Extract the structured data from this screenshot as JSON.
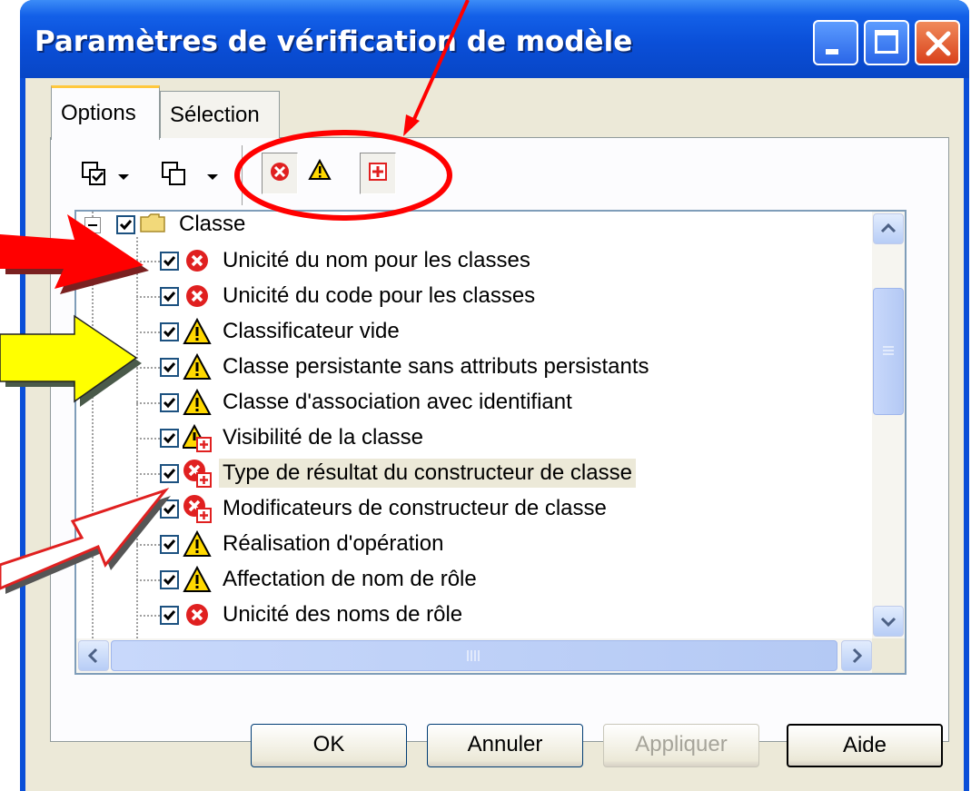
{
  "window": {
    "title": "Paramètres de vérification de modèle",
    "accent": "#0a4fd8"
  },
  "tabs": [
    {
      "label": "Options",
      "active": true
    },
    {
      "label": "Sélection",
      "active": false
    }
  ],
  "toolbar": {
    "icons": [
      "select-all-icon",
      "deselect-all-icon",
      "error-filter-icon",
      "warning-filter-icon",
      "auto-fix-filter-icon"
    ]
  },
  "tree": {
    "root": {
      "label": "Classe",
      "checked": true
    },
    "items": [
      {
        "label": "Unicité du nom pour les classes",
        "severity": "error",
        "checked": true
      },
      {
        "label": "Unicité du code pour les classes",
        "severity": "error",
        "checked": true
      },
      {
        "label": "Classificateur vide",
        "severity": "warning",
        "checked": true
      },
      {
        "label": "Classe persistante sans attributs persistants",
        "severity": "warning",
        "checked": true
      },
      {
        "label": "Classe d'association avec identifiant",
        "severity": "warning",
        "checked": true
      },
      {
        "label": "Visibilité de la classe",
        "severity": "warning-fix",
        "checked": true
      },
      {
        "label": "Type de résultat du constructeur de classe",
        "severity": "error-fix",
        "checked": true,
        "selected": true
      },
      {
        "label": "Modificateurs de constructeur de classe",
        "severity": "error-fix",
        "checked": true
      },
      {
        "label": "Réalisation d'opération",
        "severity": "warning",
        "checked": true
      },
      {
        "label": "Affectation de nom de rôle",
        "severity": "warning",
        "checked": true
      },
      {
        "label": "Unicité des noms de rôle",
        "severity": "error",
        "checked": true
      }
    ]
  },
  "buttons": {
    "ok": "OK",
    "cancel": "Annuler",
    "apply": "Appliquer",
    "help": "Aide"
  },
  "colors": {
    "error": "#e02020",
    "warning": "#ffd800",
    "annotation_red": "#ff0000",
    "annotation_yellow": "#ffff00",
    "annotation_white": "#ffffff"
  }
}
